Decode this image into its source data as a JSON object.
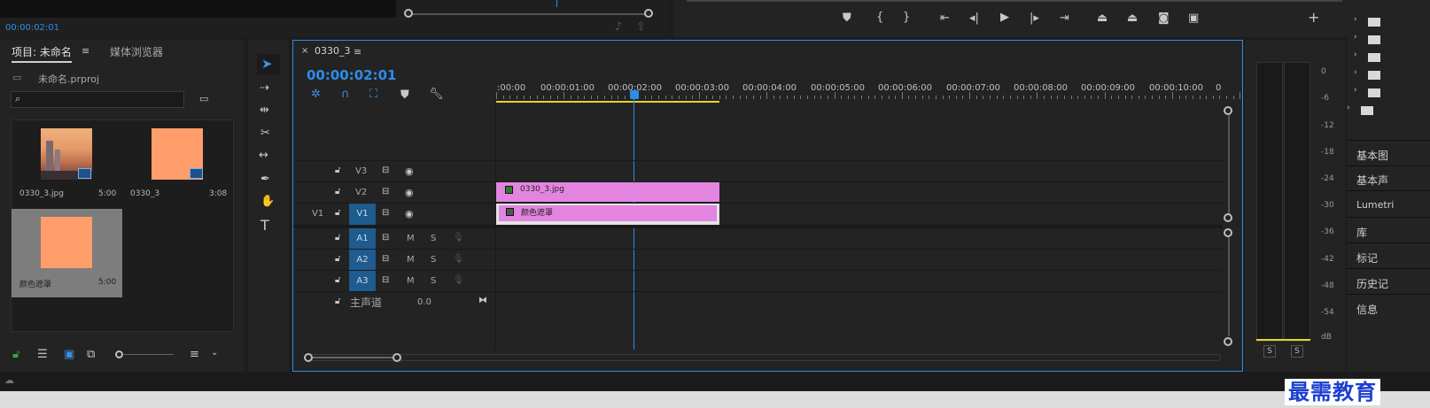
{
  "source_monitor": {
    "timecode": "00:00:02:01"
  },
  "project": {
    "tab_active": "项目: 未命名",
    "tab_media": "媒体浏览器",
    "file_name": "未命名.prproj",
    "search_placeholder": "",
    "items": [
      {
        "name": "0330_3.jpg",
        "duration": "5:00"
      },
      {
        "name": "0330_3",
        "duration": "3:08"
      },
      {
        "name": "颜色遮罩",
        "duration": "5:00"
      }
    ]
  },
  "timeline": {
    "sequence_name": "0330_3",
    "timecode": "00:00:02:01",
    "ruler": [
      ":00:00",
      "00:00:01:00",
      "00:00:02:00",
      "00:00:03:00",
      "00:00:04:00",
      "00:00:05:00",
      "00:00:06:00",
      "00:00:07:00",
      "00:00:08:00",
      "00:00:09:00",
      "00:00:10:00",
      "0"
    ],
    "video_tracks": [
      {
        "label": "V3"
      },
      {
        "label": "V2"
      },
      {
        "label": "V1",
        "source": "V1"
      }
    ],
    "audio_tracks": [
      {
        "label": "A1",
        "m": "M",
        "s": "S"
      },
      {
        "label": "A2",
        "m": "M",
        "s": "S"
      },
      {
        "label": "A3",
        "m": "M",
        "s": "S"
      }
    ],
    "master_label": "主声道",
    "master_value": "0.0",
    "clips": [
      {
        "track": "V2",
        "label": "0330_3.jpg"
      },
      {
        "track": "V1",
        "label": "颜色遮罩"
      }
    ]
  },
  "meters": {
    "scale": [
      "0",
      "-6",
      "-12",
      "-18",
      "-24",
      "-30",
      "-36",
      "-42",
      "-48",
      "-54",
      "dB"
    ],
    "solo_left": "S",
    "solo_right": "S"
  },
  "right_panel": {
    "items": [
      "基本图",
      "基本声",
      "Lumetri",
      "库",
      "标记",
      "历史记",
      "信息"
    ]
  },
  "watermark": "最需教育",
  "colors": {
    "accent": "#2d8ceb",
    "clip_pink": "#e385e0",
    "track_blue": "#1e5b8e",
    "thumb_orange": "#ff9e6a"
  }
}
